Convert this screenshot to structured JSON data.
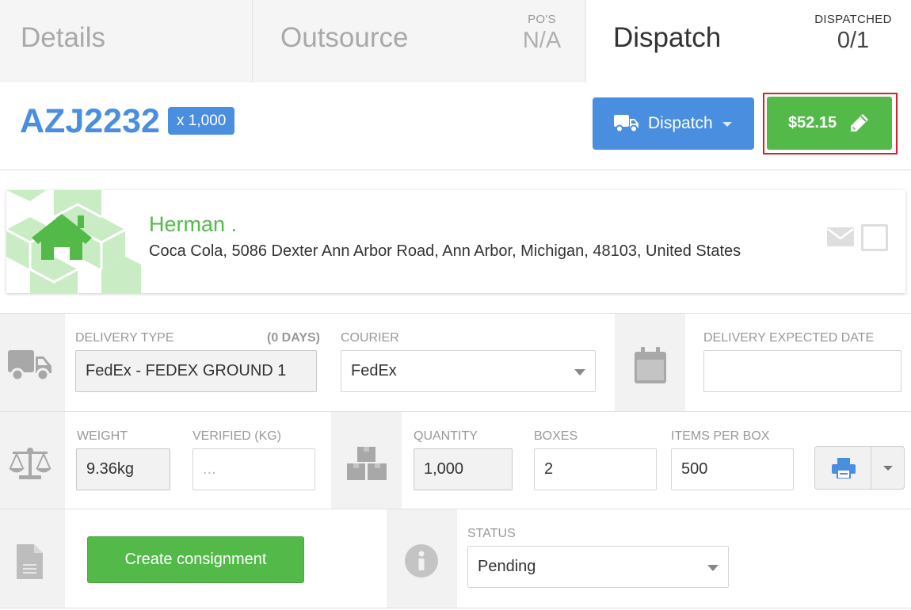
{
  "tabs": {
    "details": "Details",
    "outsource": "Outsource",
    "pos_label": "PO'S",
    "pos_value": "N/A",
    "dispatch": "Dispatch",
    "dispatched_label": "DISPATCHED",
    "dispatched_value": "0/1"
  },
  "header": {
    "part_number": "AZJ2232",
    "quantity_badge": "x 1,000",
    "dispatch_button": "Dispatch",
    "price_button": "$52.15"
  },
  "recipient": {
    "name": "Herman .",
    "address": "Coca Cola, 5086 Dexter Ann Arbor Road, Ann Arbor, Michigan, 48103, United States"
  },
  "delivery": {
    "type_label": "DELIVERY TYPE",
    "days_label": "(0 DAYS)",
    "type_value": "FedEx - FEDEX GROUND 1",
    "courier_label": "COURIER",
    "courier_value": "FedEx",
    "expected_date_label": "DELIVERY EXPECTED DATE",
    "expected_date_value": ""
  },
  "measurements": {
    "weight_label": "WEIGHT",
    "weight_value": "9.36kg",
    "verified_label": "VERIFIED (KG)",
    "verified_placeholder": "...",
    "quantity_label": "QUANTITY",
    "quantity_value": "1,000",
    "boxes_label": "BOXES",
    "boxes_value": "2",
    "items_per_box_label": "ITEMS PER BOX",
    "items_per_box_value": "500"
  },
  "consignment": {
    "create_button": "Create consignment",
    "status_label": "STATUS",
    "status_value": "Pending"
  },
  "colors": {
    "primary": "#4a8ee0",
    "success": "#53ba4a",
    "highlight": "#d6202c"
  },
  "icons": [
    "truck-icon",
    "caret-down-icon",
    "pencil-icon",
    "home-icon",
    "envelope-icon",
    "calendar-icon",
    "balance-scale-icon",
    "boxes-icon",
    "print-icon",
    "document-icon",
    "info-icon"
  ]
}
